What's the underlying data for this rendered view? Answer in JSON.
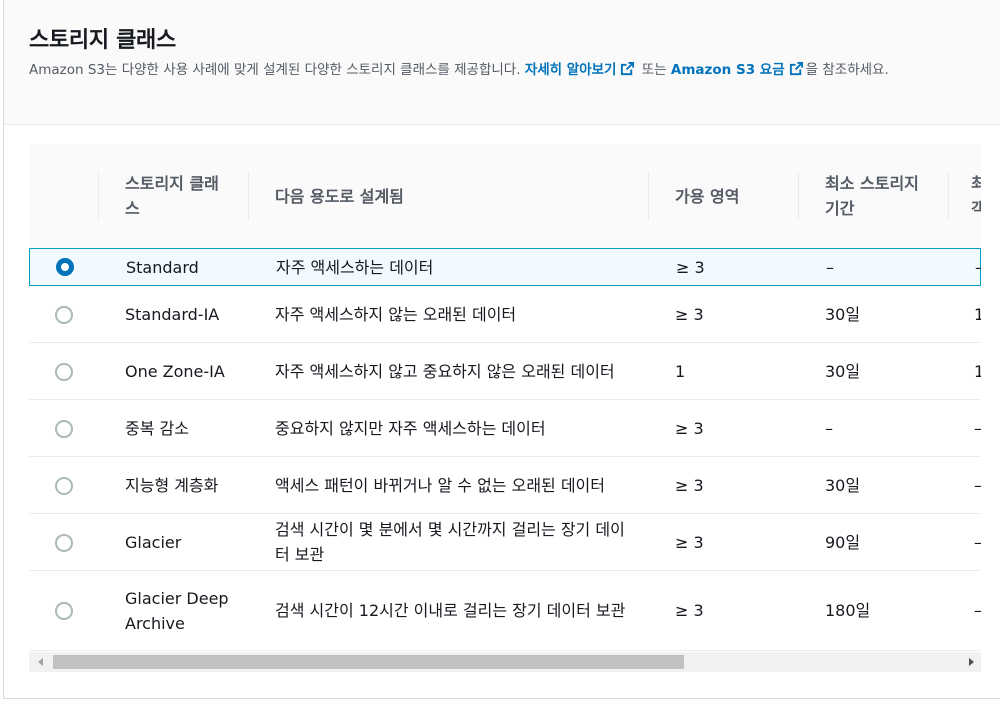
{
  "header": {
    "title": "스토리지 클래스",
    "desc_prefix": "Amazon S3는 다양한 사용 사례에 맞게 설계된 다양한 스토리지 클래스를 제공합니다.",
    "learn_more": "자세히 알아보기",
    "or_text": "또는",
    "pricing_link": "Amazon S3 요금",
    "desc_suffix": "을 참조하세요."
  },
  "table": {
    "columns": [
      "스토리지 클래스",
      "다음 용도로 설계됨",
      "가용 영역",
      "최소 스토리지 기간",
      "최소 청구 가능 객체 크기"
    ],
    "rows": [
      {
        "class": "Standard",
        "use": "자주 액세스하는 데이터",
        "az": "≥ 3",
        "min_dur": "–",
        "min_size": "–",
        "selected": true
      },
      {
        "class": "Standard-IA",
        "use": "자주 액세스하지 않는 오래된 데이터",
        "az": "≥ 3",
        "min_dur": "30일",
        "min_size": "1",
        "selected": false
      },
      {
        "class": "One Zone-IA",
        "use": "자주 액세스하지 않고 중요하지 않은 오래된 데이터",
        "az": "1",
        "min_dur": "30일",
        "min_size": "1",
        "selected": false
      },
      {
        "class": "중복 감소",
        "use": "중요하지 않지만 자주 액세스하는 데이터",
        "az": "≥ 3",
        "min_dur": "–",
        "min_size": "–",
        "selected": false
      },
      {
        "class": "지능형 계층화",
        "use": "액세스 패턴이 바뀌거나 알 수 없는 오래된 데이터",
        "az": "≥ 3",
        "min_dur": "30일",
        "min_size": "–",
        "selected": false
      },
      {
        "class": "Glacier",
        "use": "검색 시간이 몇 분에서 몇 시간까지 걸리는 장기 데이터 보관",
        "az": "≥ 3",
        "min_dur": "90일",
        "min_size": "–",
        "selected": false
      },
      {
        "class": "Glacier Deep Archive",
        "use": "검색 시간이 12시간 이내로 걸리는 장기 데이터 보관",
        "az": "≥ 3",
        "min_dur": "180일",
        "min_size": "–",
        "selected": false
      }
    ]
  },
  "scroll": {
    "position_fraction": 0.0,
    "visible_fraction": 0.66
  },
  "colors": {
    "link": "#0073bb",
    "selected_border": "#00a1c9",
    "selected_bg": "#f1faff"
  }
}
